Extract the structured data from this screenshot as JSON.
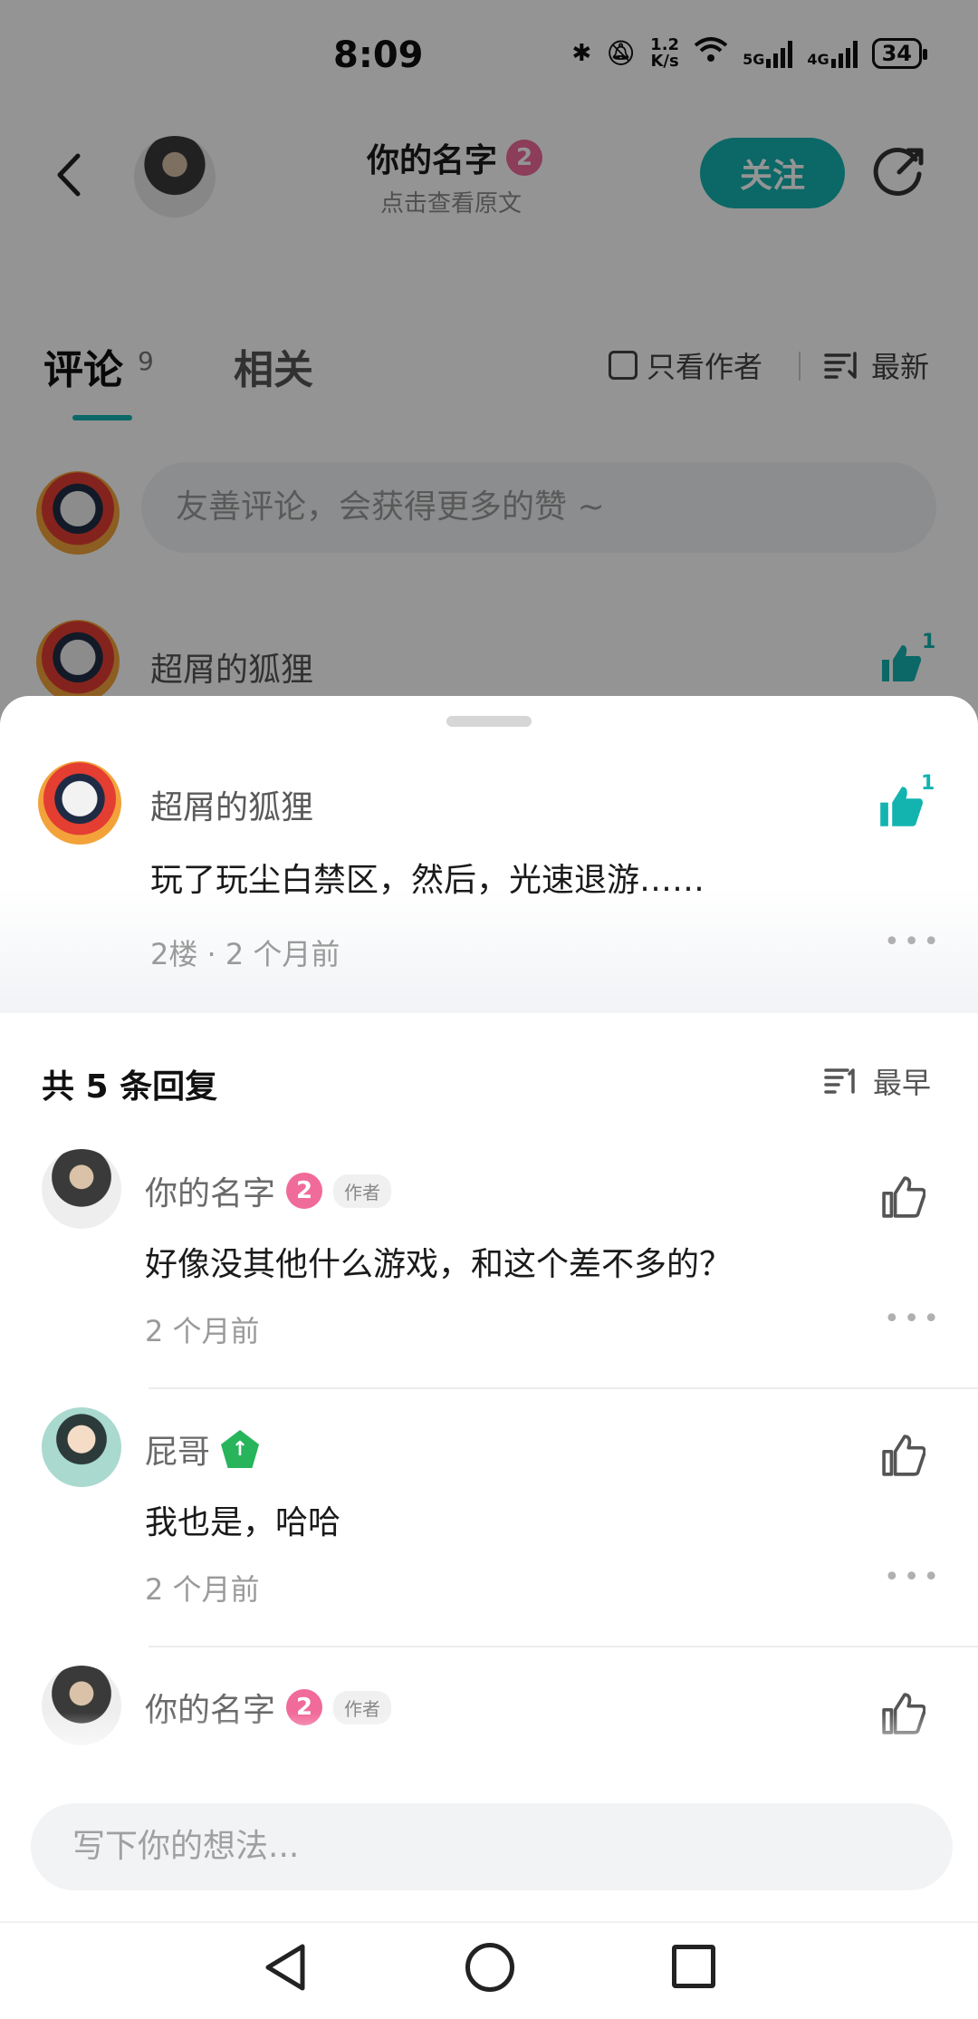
{
  "status_bar": {
    "time": "8:09",
    "net_speed_value": "1.2",
    "net_speed_unit": "K/s",
    "net_5g": "5G",
    "net_4g": "4G",
    "battery": "34"
  },
  "header": {
    "title": "你的名字",
    "level": "2",
    "subtitle": "点击查看原文",
    "follow_label": "关注"
  },
  "tabs": {
    "comments_label": "评论",
    "comments_count": "9",
    "related_label": "相关",
    "only_author_label": "只看作者",
    "sort_label": "最新"
  },
  "comment_input": {
    "placeholder": "友善评论，会获得更多的赞 ~"
  },
  "background_comment": {
    "username": "超屑的狐狸",
    "like_count": "1"
  },
  "main_comment": {
    "username": "超屑的狐狸",
    "text": "玩了玩尘白禁区，然后，光速退游……",
    "meta": "2楼 · 2 个月前",
    "like_count": "1"
  },
  "replies_header": {
    "count_label": "共 5 条回复",
    "sort_label": "最早"
  },
  "replies": [
    {
      "username": "你的名字",
      "level": "2",
      "tag": "作者",
      "text": "好像没其他什么游戏，和这个差不多的？",
      "time": "2 个月前"
    },
    {
      "username": "屁哥",
      "badge": "↑",
      "text": "我也是，哈哈",
      "time": "2 个月前"
    },
    {
      "username": "你的名字",
      "level": "2",
      "tag": "作者"
    }
  ],
  "write_bar": {
    "placeholder": "写下你的想法..."
  },
  "colors": {
    "accent": "#13b3b0",
    "level_badge": "#f06a9a",
    "green_badge": "#27b45b"
  },
  "icons": {
    "back": "back-arrow-icon",
    "share": "share-icon",
    "like": "thumbs-up-icon",
    "sort": "sort-lines-icon",
    "more": "more-dots-icon"
  }
}
